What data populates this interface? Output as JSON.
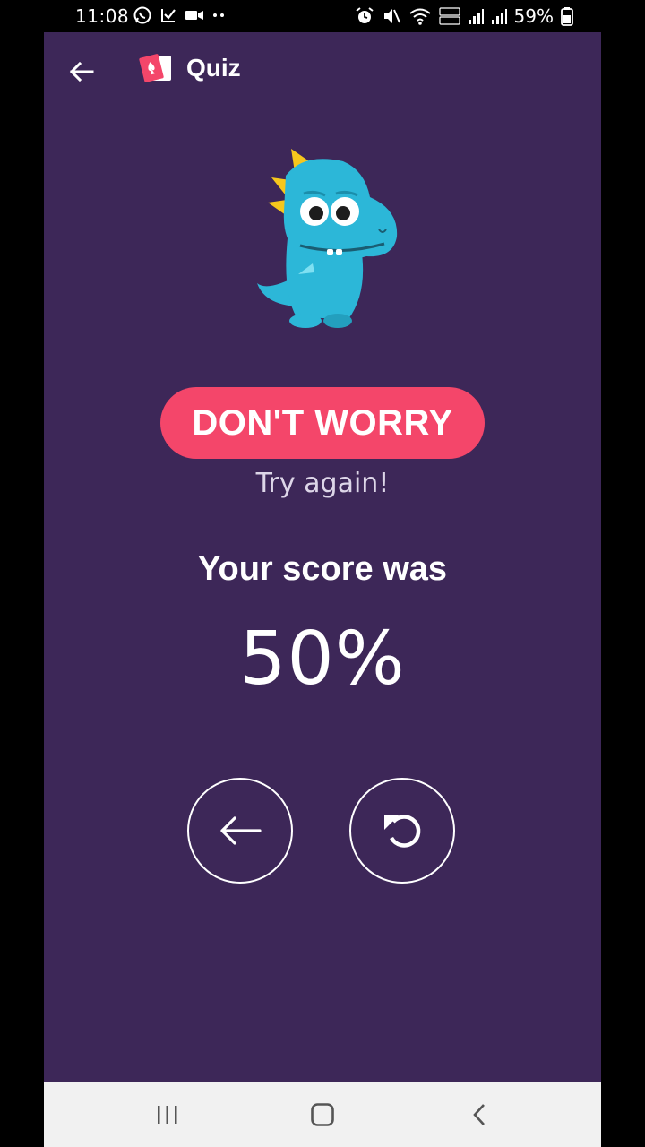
{
  "status_bar": {
    "time": "11:08",
    "battery": "59%",
    "left_icons": [
      "whatsapp-icon",
      "check-icon",
      "video-icon",
      "more-dots-icon"
    ],
    "right_icons": [
      "alarm-icon",
      "mute-icon",
      "wifi-icon",
      "signal-icon",
      "signal-icon",
      "battery-icon"
    ]
  },
  "header": {
    "title": "Quiz",
    "back_icon": "arrow-left-icon",
    "logo_icon": "quiz-cards-logo-icon"
  },
  "result": {
    "badge": "DON'T WORRY",
    "subtitle": "Try again!",
    "score_label": "Your score was",
    "score_value": "50%"
  },
  "actions": {
    "back_icon": "arrow-left-icon",
    "retry_icon": "retry-icon"
  },
  "nav_bar": {
    "buttons": [
      "recents-icon",
      "home-icon",
      "back-icon"
    ]
  },
  "colors": {
    "background": "#3d2758",
    "accent": "#f4466a",
    "mascot": "#2cb7d8"
  }
}
